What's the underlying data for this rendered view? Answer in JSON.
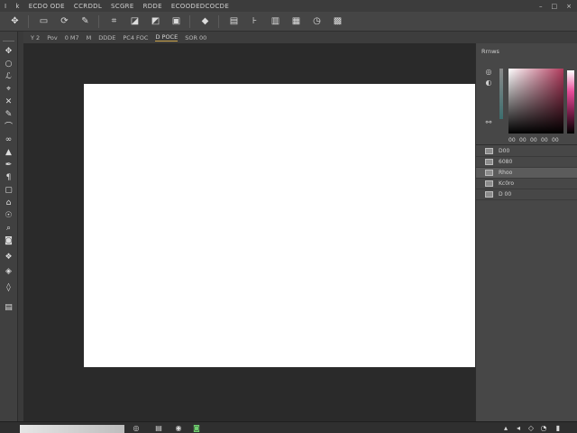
{
  "menu": {
    "items": [
      "I",
      "k",
      "ECDO ODE",
      "CCRDDL",
      "SCGRE",
      "RDDE",
      "ECOODEDCOCDE"
    ],
    "window_controls": [
      "–",
      "□",
      "×"
    ]
  },
  "toolbar": {
    "icons": [
      "move-icon",
      "new-document-icon",
      "rotate-icon",
      "wand-icon",
      "crop-icon",
      "tag-icon",
      "stamp-icon",
      "frame-icon",
      "text-icon",
      "transform-icon",
      "levels-icon",
      "settings-icon",
      "clock-icon"
    ]
  },
  "options": {
    "items": [
      "Y 2",
      "Pov",
      "0 M7",
      "M",
      "DDDE",
      "PC4 FOC",
      "D POCE",
      "SOR 00"
    ],
    "active_index": 6
  },
  "tools": {
    "icons": [
      "move-tool-icon",
      "ellipse-select-icon",
      "lasso-icon",
      "crop-tool-icon",
      "heal-icon",
      "brush-icon",
      "eraser-icon",
      "gradient-icon",
      "dodge-icon",
      "pen-icon",
      "type-icon",
      "path-select-icon",
      "shape-icon",
      "hand-icon",
      "zoom-icon",
      "foreground-color-icon",
      "mask-icon",
      "screen-mode-icon"
    ]
  },
  "panel": {
    "title": "Rrnws",
    "swatch_readout": [
      "00",
      "00",
      "00",
      "00",
      "00"
    ],
    "layers": [
      {
        "label": "D00",
        "selected": false
      },
      {
        "label": "6080",
        "selected": false
      },
      {
        "label": "Rhoo",
        "selected": true
      },
      {
        "label": "Kc0ro",
        "selected": false
      },
      {
        "label": "D 00",
        "selected": false
      }
    ]
  },
  "status": {
    "icons": [
      "image-icon",
      "document-icon",
      "globe-icon",
      "green-status-icon",
      "up-arrow-icon",
      "speaker-icon",
      "network-icon",
      "wifi-icon",
      "battery-icon"
    ]
  },
  "colors": {
    "accent": "#c9a24a",
    "canvas_bg": "#2a2a2a",
    "document": "#ffffff"
  }
}
